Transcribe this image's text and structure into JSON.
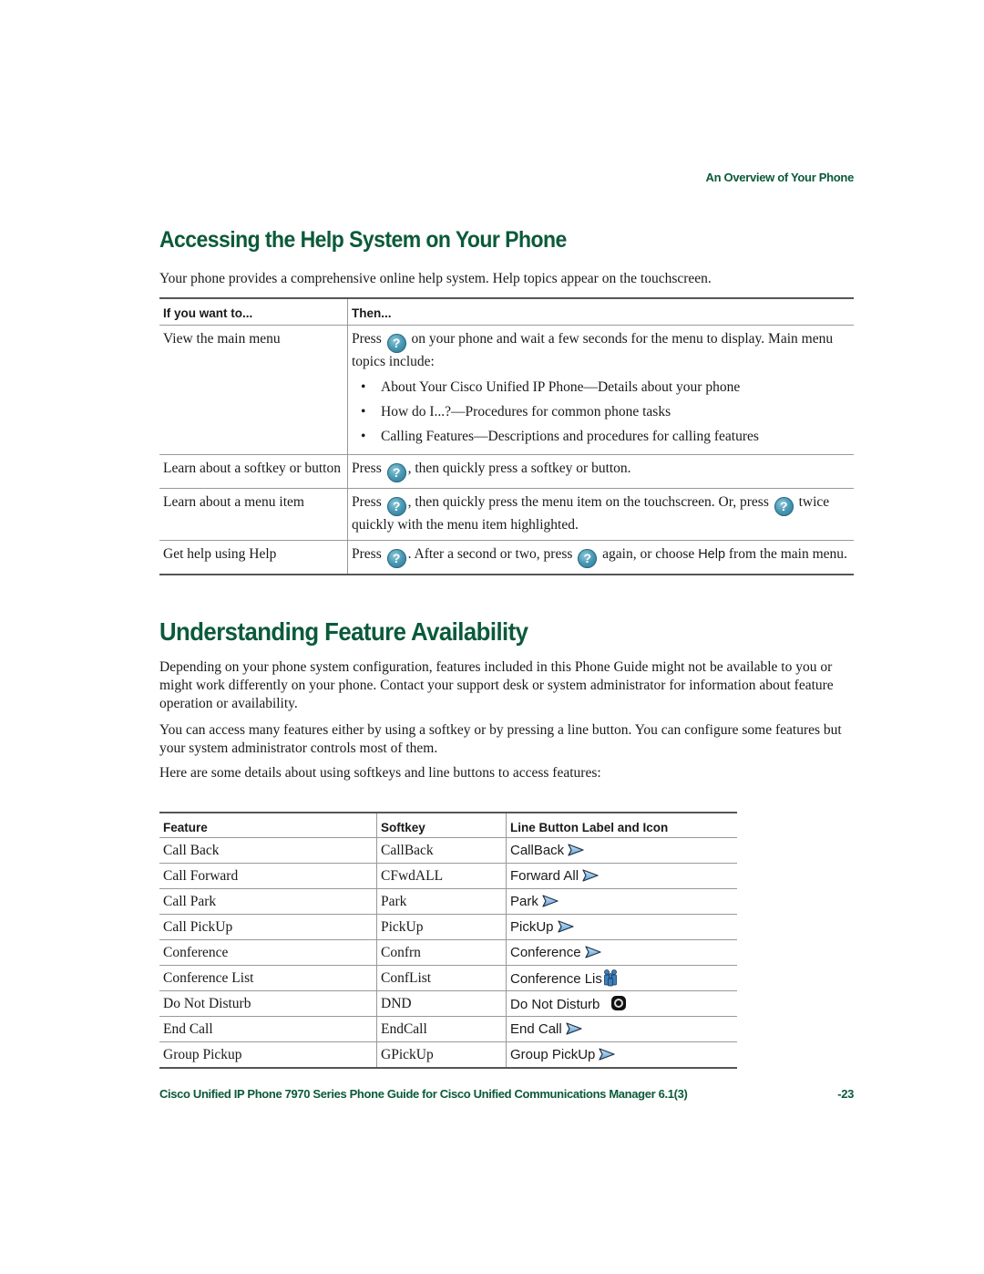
{
  "running_header": "An Overview of Your Phone",
  "section_help": {
    "title": "Accessing the Help System on Your Phone",
    "intro": "Your phone provides a comprehensive online help system. Help topics appear on the touchscreen.",
    "table": {
      "headers": [
        "If you want to...",
        "Then..."
      ],
      "rows": [
        {
          "action": "View the main menu",
          "then_before_icon": "Press",
          "then_after_icon": "on your phone and wait a few seconds for the menu to display. Main menu topics include:",
          "bullets": [
            "About Your Cisco Unified IP Phone—Details about your phone",
            "How do I...?—Procedures for common phone tasks",
            "Calling Features—Descriptions and procedures for calling features"
          ]
        },
        {
          "action": "Learn about a softkey or button",
          "then_before_icon": "Press",
          "then_after_icon": ", then quickly press a softkey or button."
        },
        {
          "action": "Learn about a menu item",
          "then_before_icon": "Press",
          "then_after_icon": ", then quickly press the menu item on the touchscreen. Or, press",
          "then_after_icon2": "twice quickly with the menu item highlighted."
        },
        {
          "action": "Get help using Help",
          "then_before_icon": "Press",
          "then_after_icon": ". After a second or two, press",
          "then_after_icon2": "again, or choose",
          "ui_word": "Help",
          "then_end": "from the main menu."
        }
      ]
    },
    "help_icon_glyph": "?",
    "help_icon_name": "help-question-icon"
  },
  "section_feature": {
    "title": "Understanding Feature Availability",
    "paragraphs": [
      "Depending on your phone system configuration, features included in this Phone Guide might not be available to you or might work differently on your phone. Contact your support desk or system administrator for information about feature operation or availability.",
      "You can access many features either by using a softkey or by pressing a line button. You can configure some features but your system administrator controls most of them.",
      "Here are some details about using softkeys and line buttons to access features:"
    ],
    "table": {
      "headers": [
        "Feature",
        "Softkey",
        "Line Button Label and Icon"
      ],
      "rows": [
        {
          "feature": "Call Back",
          "softkey": "CallBack",
          "label": "CallBack",
          "icon": "arrow"
        },
        {
          "feature": "Call Forward",
          "softkey": "CFwdALL",
          "label": "Forward All",
          "icon": "arrow"
        },
        {
          "feature": "Call Park",
          "softkey": "Park",
          "label": "Park",
          "icon": "arrow"
        },
        {
          "feature": "Call PickUp",
          "softkey": "PickUp",
          "label": "PickUp",
          "icon": "arrow"
        },
        {
          "feature": "Conference",
          "softkey": "Confrn",
          "label": "Conference",
          "icon": "arrow"
        },
        {
          "feature": "Conference List",
          "softkey": "ConfList",
          "label": "Conference Lis",
          "icon": "conference-list"
        },
        {
          "feature": "Do Not Disturb",
          "softkey": "DND",
          "label": "Do Not Disturb",
          "icon": "dnd"
        },
        {
          "feature": "End Call",
          "softkey": "EndCall",
          "label": "End Call",
          "icon": "arrow"
        },
        {
          "feature": "Group Pickup",
          "softkey": "GPickUp",
          "label": "Group PickUp",
          "icon": "arrow"
        }
      ]
    }
  },
  "footer": {
    "title": "Cisco Unified IP Phone 7970 Series Phone Guide for Cisco Unified Communications Manager 6.1(3)",
    "page": "-23"
  },
  "colors": {
    "heading_green": "#0b5a3a",
    "help_icon_blue": "#4a9ab5",
    "line_icon_blue": "#7fb6e0"
  }
}
